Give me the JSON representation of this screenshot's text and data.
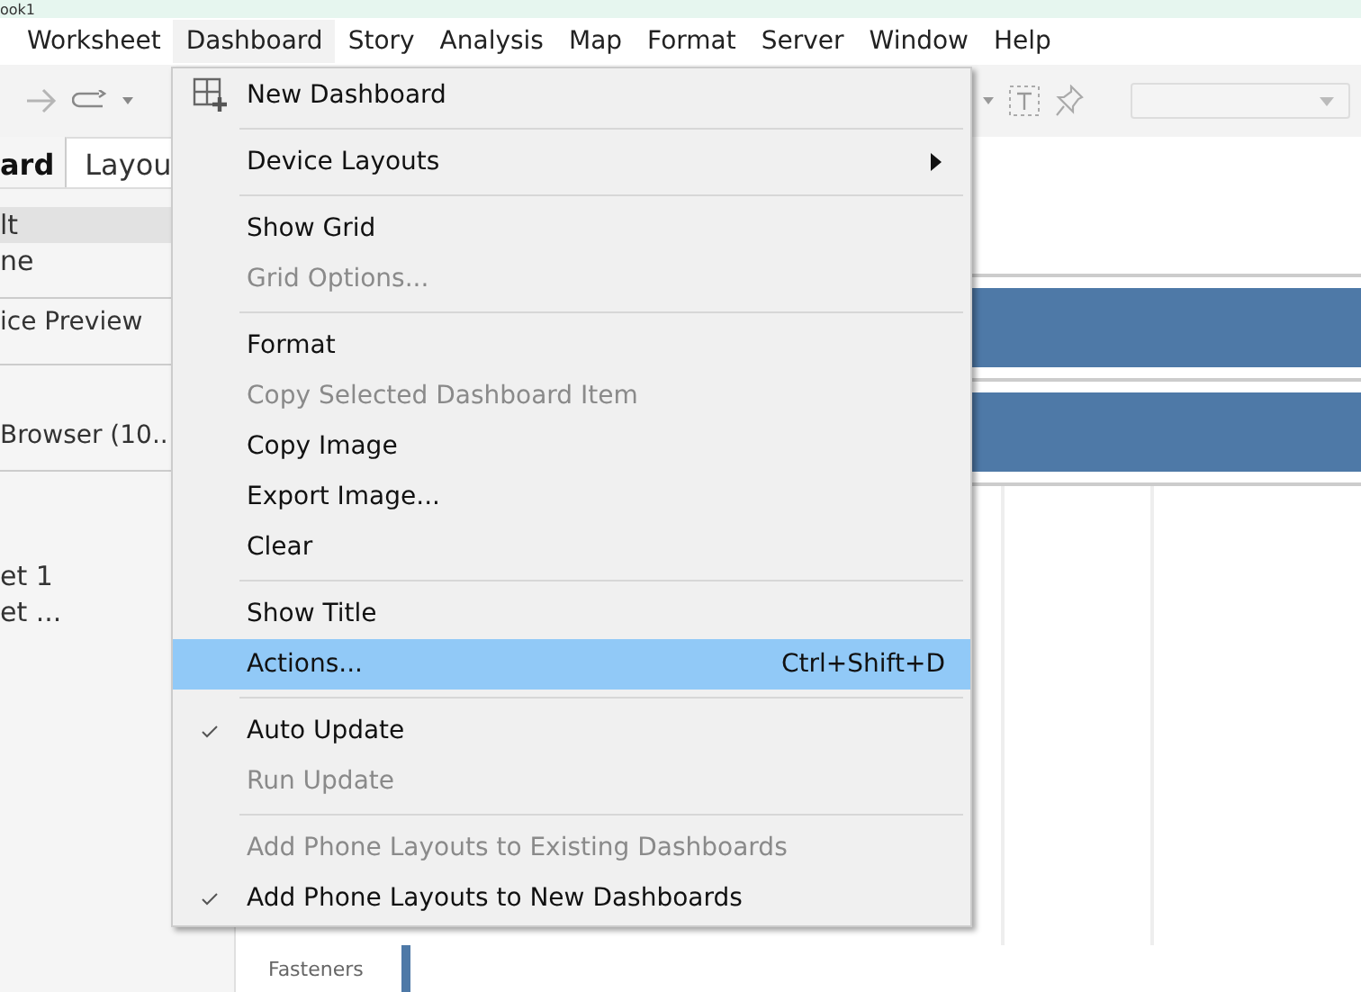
{
  "window": {
    "title": "ook1"
  },
  "menu_bar": [
    {
      "label": "Worksheet",
      "selected": false
    },
    {
      "label": "Dashboard",
      "selected": true
    },
    {
      "label": "Story",
      "selected": false
    },
    {
      "label": "Analysis",
      "selected": false
    },
    {
      "label": "Map",
      "selected": false
    },
    {
      "label": "Format",
      "selected": false
    },
    {
      "label": "Server",
      "selected": false
    },
    {
      "label": "Window",
      "selected": false
    },
    {
      "label": "Help",
      "selected": false
    }
  ],
  "side_panel": {
    "tabs": [
      {
        "label": "ard",
        "selected": true
      },
      {
        "label": "Layou",
        "selected": false
      }
    ],
    "size_items": [
      {
        "label": "lt",
        "selected": true
      },
      {
        "label": "ne",
        "selected": false
      }
    ],
    "device_preview": "ice Preview",
    "browser": "Browser (10..",
    "sheets": [
      "et 1",
      "et ..."
    ]
  },
  "chart": {
    "row_label": "Fasteners"
  },
  "dashboard_menu": [
    {
      "kind": "item",
      "label": "New Dashboard",
      "disabled": false,
      "checked": false,
      "submenu": false,
      "selected": false
    },
    {
      "kind": "separator"
    },
    {
      "kind": "item",
      "label": "Device Layouts",
      "disabled": false,
      "checked": false,
      "submenu": true,
      "selected": false
    },
    {
      "kind": "separator"
    },
    {
      "kind": "item",
      "label": "Show Grid",
      "disabled": false,
      "checked": false,
      "submenu": false,
      "selected": false
    },
    {
      "kind": "item",
      "label": "Grid Options...",
      "disabled": true,
      "checked": false,
      "submenu": false,
      "selected": false
    },
    {
      "kind": "separator"
    },
    {
      "kind": "item",
      "label": "Format",
      "disabled": false,
      "checked": false,
      "submenu": false,
      "selected": false
    },
    {
      "kind": "item",
      "label": "Copy Selected Dashboard Item",
      "disabled": true,
      "checked": false,
      "submenu": false,
      "selected": false
    },
    {
      "kind": "item",
      "label": "Copy Image",
      "disabled": false,
      "checked": false,
      "submenu": false,
      "selected": false
    },
    {
      "kind": "item",
      "label": "Export Image...",
      "disabled": false,
      "checked": false,
      "submenu": false,
      "selected": false
    },
    {
      "kind": "item",
      "label": "Clear",
      "disabled": false,
      "checked": false,
      "submenu": false,
      "selected": false
    },
    {
      "kind": "separator"
    },
    {
      "kind": "item",
      "label": "Show Title",
      "disabled": false,
      "checked": false,
      "submenu": false,
      "selected": false
    },
    {
      "kind": "item",
      "label": "Actions...",
      "shortcut": "Ctrl+Shift+D",
      "disabled": false,
      "checked": false,
      "submenu": false,
      "selected": true
    },
    {
      "kind": "separator"
    },
    {
      "kind": "item",
      "label": "Auto Update",
      "disabled": false,
      "checked": true,
      "submenu": false,
      "selected": false
    },
    {
      "kind": "item",
      "label": "Run Update",
      "disabled": true,
      "checked": false,
      "submenu": false,
      "selected": false
    },
    {
      "kind": "separator"
    },
    {
      "kind": "item",
      "label": "Add Phone Layouts to Existing Dashboards",
      "disabled": true,
      "checked": false,
      "submenu": false,
      "selected": false
    },
    {
      "kind": "item",
      "label": "Add Phone Layouts to New Dashboards",
      "disabled": false,
      "checked": true,
      "submenu": false,
      "selected": false
    }
  ]
}
